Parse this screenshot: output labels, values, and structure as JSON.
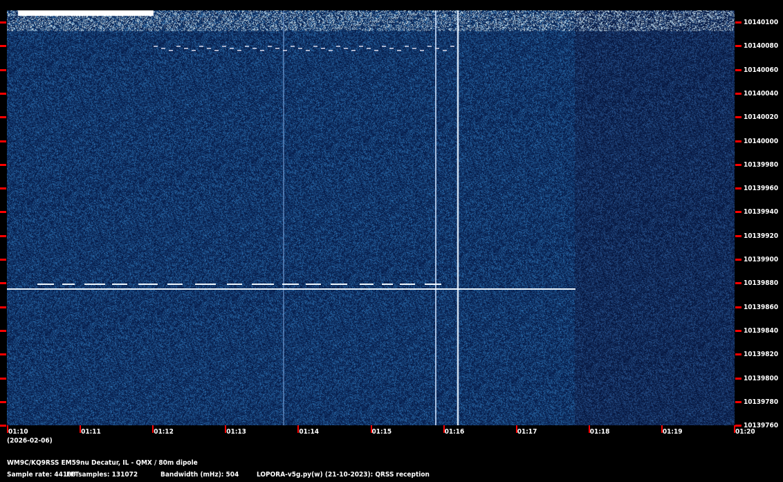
{
  "freq_axis": {
    "labels": [
      "10140100",
      "10140080",
      "10140060",
      "10140040",
      "10140020",
      "10140000",
      "10139980",
      "10139960",
      "10139940",
      "10139920",
      "10139900",
      "10139880",
      "10139860",
      "10139840",
      "10139820",
      "10139800",
      "10139780",
      "10139760"
    ]
  },
  "time_axis": {
    "labels": [
      "01:10",
      "01:11",
      "01:12",
      "01:13",
      "01:14",
      "01:15",
      "01:16",
      "01:17",
      "01:18",
      "01:19",
      "01:20"
    ],
    "date": "(2026-02-06)"
  },
  "station": "WM9C/KQ9RSS EM59nu Decatur, IL - QMX / 80m dipole",
  "params": {
    "sample_rate": "Sample rate: 44100",
    "fft_samples": "FFTsamples: 131072",
    "bandwidth": "Bandwidth (mHz): 504",
    "software": "LOPORA-v5g.py(w) (21-10-2023): QRSS reception"
  },
  "colors": {
    "background": "#000000",
    "spectrum_base": "#0b2560",
    "tick": "#ff0000",
    "signal": "#e8f4ff"
  }
}
